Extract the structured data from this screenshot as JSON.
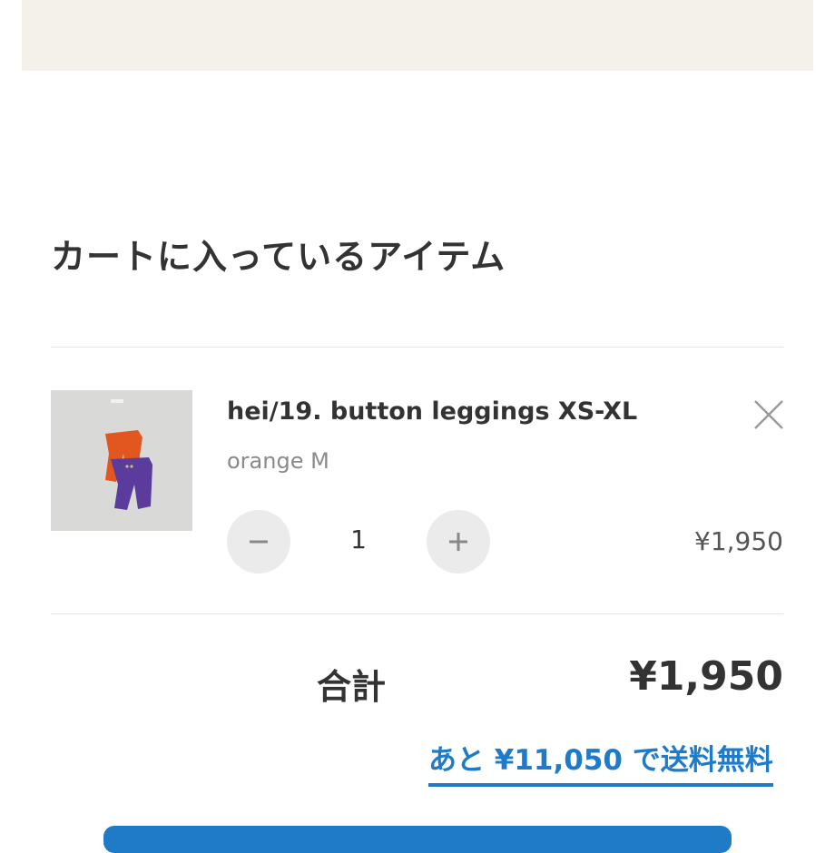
{
  "cart": {
    "heading": "カートに入っているアイテム",
    "items": [
      {
        "name": "hei/19. button leggings XS-XL",
        "variant": "orange M",
        "quantity": "1",
        "price": "¥1,950",
        "image_icon": "leggings-photo",
        "decrease_icon": "minus-icon",
        "increase_icon": "plus-icon",
        "remove_icon": "close-icon"
      }
    ]
  },
  "summary": {
    "total_label": "合計",
    "total_value": "¥1,950",
    "free_shipping_message": "あと ¥11,050 で送料無料"
  },
  "colors": {
    "accent": "#1f7bc8",
    "banner_bg": "#f4f0ea",
    "text": "#333333",
    "muted_text": "#8a8a8a",
    "qty_button_bg": "#ebebeb"
  }
}
